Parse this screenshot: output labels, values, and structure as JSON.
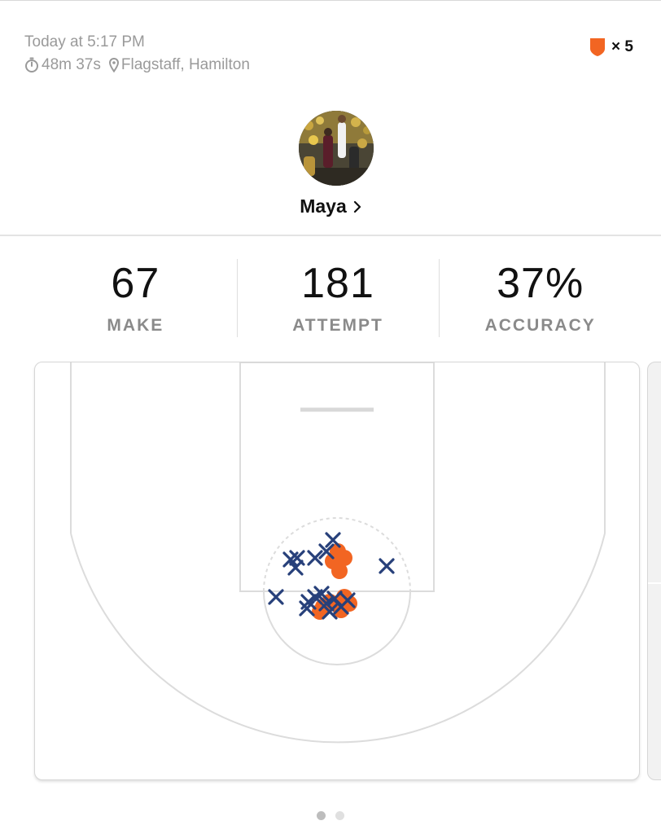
{
  "session": {
    "date_text": "Today at 5:17 PM",
    "duration": "48m 37s",
    "location": "Flagstaff, Hamilton"
  },
  "badge": {
    "icon": "shield-icon",
    "color": "#f26522",
    "count": "× 5"
  },
  "player": {
    "name": "Maya",
    "avatar": "player-avatar-photo"
  },
  "stats": [
    {
      "value": "67",
      "label": "MAKE"
    },
    {
      "value": "181",
      "label": "ATTEMPT"
    },
    {
      "value": "37%",
      "label": "ACCURACY"
    }
  ],
  "colors": {
    "make": "#f26522",
    "miss": "#27407a",
    "court_lines": "#dcdcdc"
  },
  "pagination": {
    "pages": 2,
    "active": 1
  }
}
